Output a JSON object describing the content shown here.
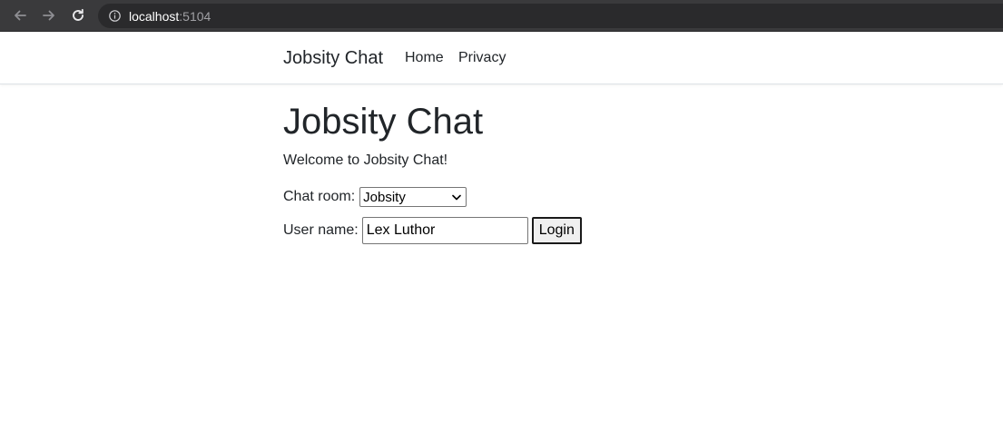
{
  "browser": {
    "url_host": "localhost",
    "url_port": ":5104",
    "icons": [
      "back-arrow-icon",
      "forward-arrow-icon",
      "reload-icon",
      "info-icon"
    ]
  },
  "navbar": {
    "brand": "Jobsity Chat",
    "links": [
      "Home",
      "Privacy"
    ]
  },
  "main": {
    "title": "Jobsity Chat",
    "welcome": "Welcome to Jobsity Chat!",
    "chat_room_label": "Chat room:",
    "chat_room_selected": "Jobsity",
    "user_name_label": "User name:",
    "user_name_value": "Lex Luthor",
    "login_label": "Login"
  },
  "colors": {
    "browser_chrome": "#3a3a3c",
    "text": "#212529",
    "border": "#dee2e6"
  }
}
